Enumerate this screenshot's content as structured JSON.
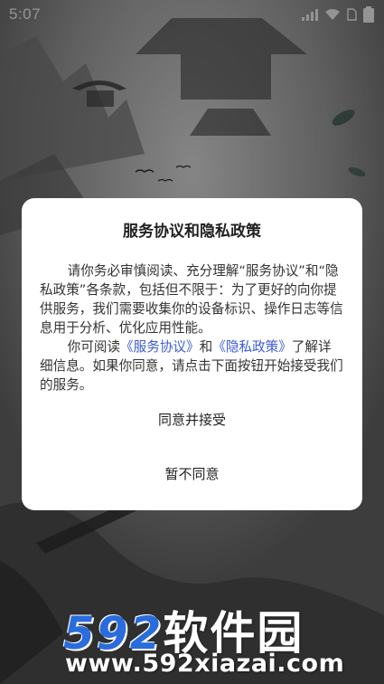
{
  "status_bar": {
    "time": "5:07",
    "icons": [
      "signal-icon",
      "wifi-icon",
      "sim-icon",
      "battery-icon"
    ]
  },
  "dialog": {
    "title": "服务协议和隐私政策",
    "paragraph1": "请你务必审慎阅读、充分理解“服务协议”和“隐私政策”各条款，包括但不限于：为了更好的向你提供服务，我们需要收集你的设备标识、操作日志等信息用于分析、优化应用性能。",
    "paragraph2_prefix": "你可阅读",
    "service_link": "《服务协议》",
    "paragraph2_middle": "和",
    "privacy_link": "《隐私政策》",
    "paragraph2_suffix": "了解详细信息。如果你同意，请点击下面按钮开始接受我们的服务。",
    "agree_button": "同意并接受",
    "disagree_button": "暂不同意"
  },
  "watermark": {
    "number": "592",
    "chinese": "软件园",
    "url": "www.592xiazai.com"
  },
  "colors": {
    "link": "#3b5bd6",
    "watermark_blue": "#2a6cdc",
    "dialog_bg": "#ffffff"
  }
}
